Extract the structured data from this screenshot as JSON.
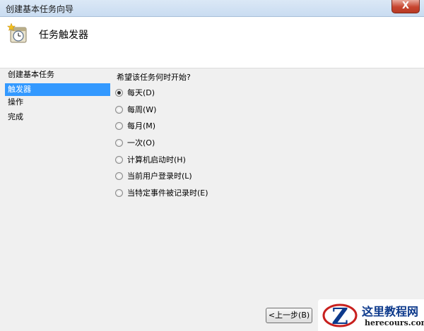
{
  "window": {
    "title": "创建基本任务向导",
    "close_label": "X"
  },
  "header": {
    "title": "任务触发器",
    "icon": "task-scheduler-clock-icon"
  },
  "sidebar": {
    "items": [
      {
        "label": "创建基本任务",
        "active": false
      },
      {
        "label": "触发器",
        "active": true
      },
      {
        "label": "操作",
        "active": false
      },
      {
        "label": "完成",
        "active": false
      }
    ]
  },
  "content": {
    "question": "希望该任务何时开始?",
    "options": [
      {
        "label": "每天(D)",
        "checked": true
      },
      {
        "label": "每周(W)",
        "checked": false
      },
      {
        "label": "每月(M)",
        "checked": false
      },
      {
        "label": "一次(O)",
        "checked": false
      },
      {
        "label": "计算机启动时(H)",
        "checked": false
      },
      {
        "label": "当前用户登录时(L)",
        "checked": false
      },
      {
        "label": "当特定事件被记录时(E)",
        "checked": false
      }
    ]
  },
  "footer": {
    "back_label": "<上一步(B)"
  },
  "watermark": {
    "cn": "这里教程网",
    "en": "herecours.com",
    "logo_letter": "Z"
  },
  "colors": {
    "selection": "#3399ff",
    "watermark_blue": "#0d3a8c",
    "watermark_red": "#c8201e"
  }
}
